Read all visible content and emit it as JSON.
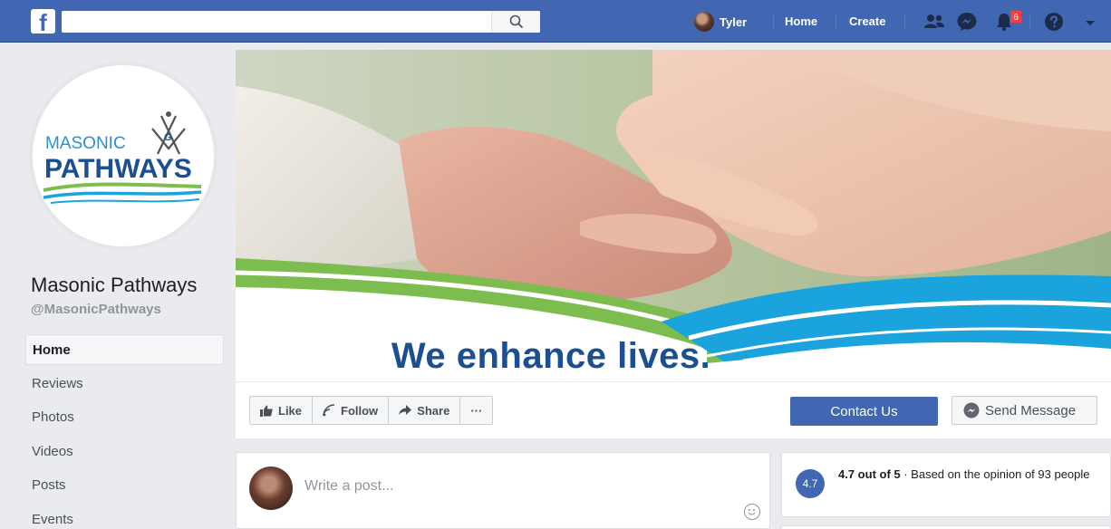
{
  "topbar": {
    "logo": "f",
    "search": {
      "value": "",
      "placeholder": ""
    },
    "user_name": "Tyler",
    "nav": [
      {
        "label": "Home"
      },
      {
        "label": "Create"
      }
    ],
    "icons": [
      "friends-icon",
      "messenger-icon",
      "notifications-icon",
      "help-icon",
      "dropdown-icon"
    ],
    "notifications_count": "6"
  },
  "page": {
    "name": "Masonic Pathways",
    "handle": "@MasonicPathways",
    "logo_text_top": "MASONIC",
    "logo_text_bottom": "PATHWAYS",
    "logo_emblem_letter": "G"
  },
  "left_nav": [
    {
      "label": "Home",
      "active": true
    },
    {
      "label": "Reviews"
    },
    {
      "label": "Photos"
    },
    {
      "label": "Videos"
    },
    {
      "label": "Posts"
    },
    {
      "label": "Events"
    }
  ],
  "cover": {
    "tagline": "We enhance lives."
  },
  "actions": {
    "like": "Like",
    "follow": "Follow",
    "share": "Share",
    "more": "···",
    "contact": "Contact Us",
    "message": "Send Message"
  },
  "composer": {
    "placeholder": "Write a post..."
  },
  "rating": {
    "value": "4.7",
    "headline": "4.7 out of 5",
    "detail": " · Based on the opinion of 93 people"
  },
  "colors": {
    "facebook_blue": "#4267b2",
    "tagline_blue": "#1b4f91",
    "wave_green": "#7dbd4f",
    "wave_cyan": "#1aa3dc"
  }
}
